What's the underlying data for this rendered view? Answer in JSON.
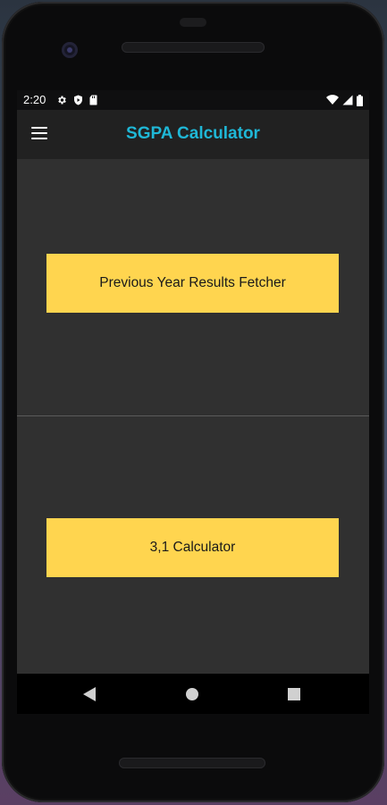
{
  "status_bar": {
    "time": "2:20",
    "left_icons": [
      "settings-icon",
      "shield-icon",
      "sd-card-icon"
    ],
    "right_icons": [
      "wifi-icon",
      "signal-icon",
      "battery-icon"
    ]
  },
  "app_bar": {
    "title": "SGPA Calculator",
    "menu_icon": "hamburger-menu-icon",
    "title_color": "#1fb7d6"
  },
  "main": {
    "buttons": [
      {
        "label": "Previous Year Results Fetcher"
      },
      {
        "label": "3,1 Calculator"
      }
    ],
    "button_color": "#ffd54f",
    "background_color": "#303030"
  },
  "nav_bar": {
    "icons": [
      "back-icon",
      "home-icon",
      "recents-icon"
    ]
  }
}
